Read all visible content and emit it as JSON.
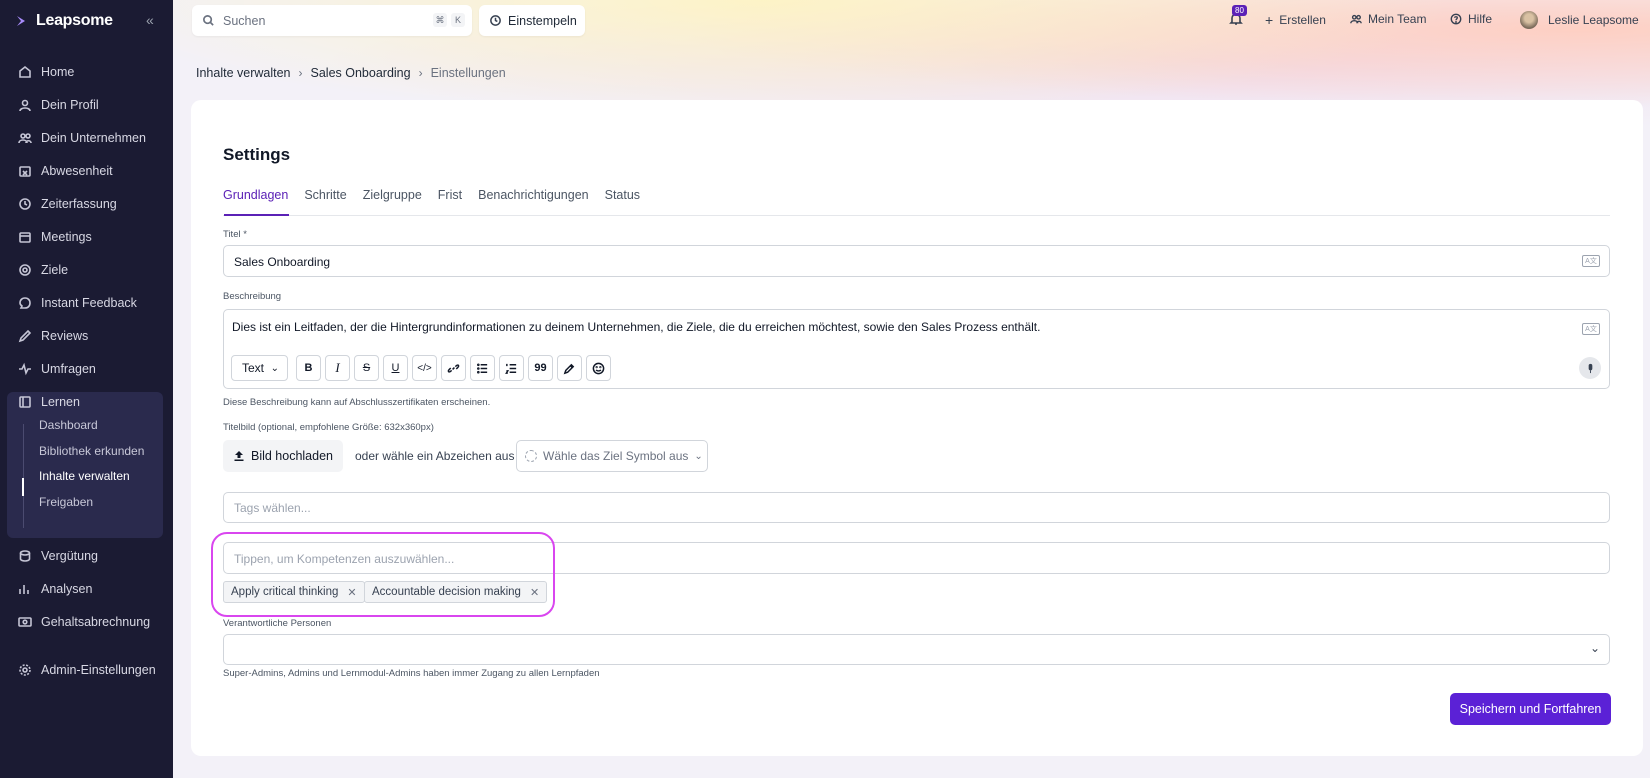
{
  "brand": {
    "name": "Leapsome"
  },
  "sidebar": {
    "items": [
      {
        "label": "Home",
        "icon": "home-icon"
      },
      {
        "label": "Dein Profil",
        "icon": "user-icon"
      },
      {
        "label": "Dein Unternehmen",
        "icon": "users-icon"
      },
      {
        "label": "Abwesenheit",
        "icon": "calendar-x-icon"
      },
      {
        "label": "Zeiterfassung",
        "icon": "clock-icon"
      },
      {
        "label": "Meetings",
        "icon": "calendar-icon"
      },
      {
        "label": "Ziele",
        "icon": "target-icon"
      },
      {
        "label": "Instant Feedback",
        "icon": "message-icon"
      },
      {
        "label": "Reviews",
        "icon": "pen-icon"
      },
      {
        "label": "Umfragen",
        "icon": "pulse-icon"
      },
      {
        "label": "Lernen",
        "icon": "book-icon"
      },
      {
        "label": "Vergütung",
        "icon": "coins-icon"
      },
      {
        "label": "Analysen",
        "icon": "chart-icon"
      },
      {
        "label": "Gehaltsabrechnung",
        "icon": "money-icon"
      },
      {
        "label": "Admin-Einstellungen",
        "icon": "gear-icon"
      }
    ],
    "learn_subitems": [
      {
        "label": "Dashboard"
      },
      {
        "label": "Bibliothek erkunden"
      },
      {
        "label": "Inhalte verwalten"
      },
      {
        "label": "Freigaben"
      }
    ]
  },
  "topbar": {
    "search_placeholder": "Suchen",
    "kbd_cmd": "⌘",
    "kbd_k": "K",
    "clock_in": "Einstempeln",
    "notifications_count": "80",
    "create": "Erstellen",
    "my_team": "Mein Team",
    "help": "Hilfe",
    "user_name": "Leslie Leapsome"
  },
  "breadcrumb": {
    "items": [
      "Inhalte verwalten",
      "Sales Onboarding"
    ],
    "current": "Einstellungen"
  },
  "page": {
    "title": "Settings",
    "tabs": [
      "Grundlagen",
      "Schritte",
      "Zielgruppe",
      "Frist",
      "Benachrichtigungen",
      "Status"
    ],
    "title_label": "Titel *",
    "title_value": "Sales Onboarding",
    "description_label": "Beschreibung",
    "description_value": "Dies ist ein Leitfaden, der die Hintergrundinformationen zu deinem Unternehmen, die Ziele, die du erreichen möchtest, sowie den Sales Prozess enthält.",
    "text_style": "Text",
    "description_hint": "Diese Beschreibung kann auf Abschlusszertifikaten erscheinen.",
    "image_label": "Titelbild (optional, empfohlene Größe: 632x360px)",
    "upload_button": "Bild hochladen",
    "or_badge_text": "oder wähle ein Abzeichen aus",
    "symbol_placeholder": "Wähle das Ziel Symbol aus",
    "tags_placeholder": "Tags wählen...",
    "skills_placeholder": "Tippen, um Kompetenzen auszuwählen...",
    "skills": [
      "Apply critical thinking",
      "Accountable decision making"
    ],
    "responsible_label": "Verantwortliche Personen",
    "responsible_hint": "Super-Admins, Admins und Lernmodul-Admins haben immer Zugang zu allen Lernpfaden",
    "save_button": "Speichern und Fortfahren"
  },
  "colors": {
    "sidebar_bg": "#1b1b33",
    "accent": "#5b21d6",
    "highlight": "#d946ef"
  }
}
